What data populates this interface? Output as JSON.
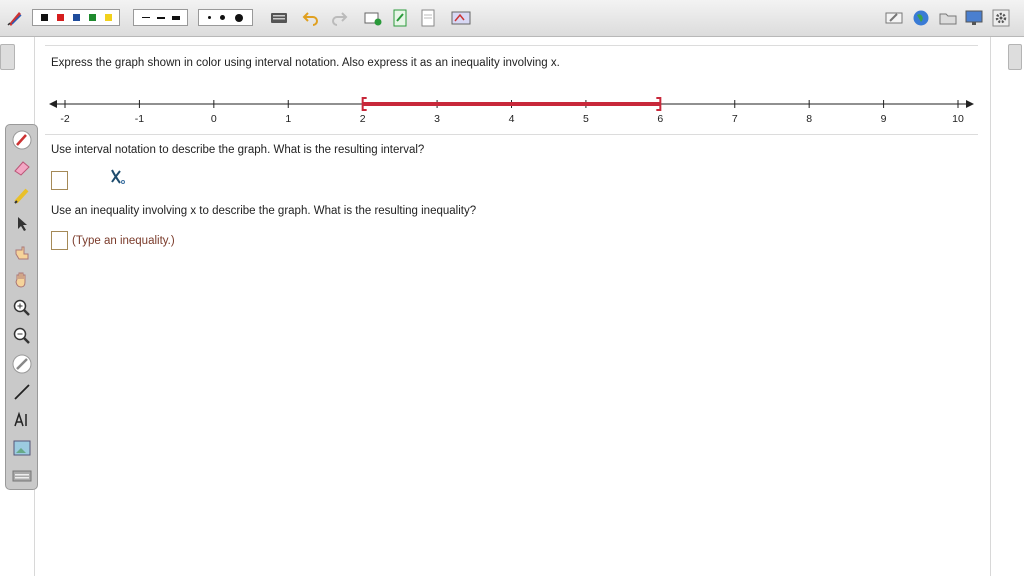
{
  "toolbar": {
    "colors": [
      "#111111",
      "#d51e1e",
      "#1f4c9c",
      "#1e8a2e",
      "#f2d11c"
    ],
    "icons": [
      "pen-logo",
      "keyboard-icon",
      "undo-icon",
      "redo-icon",
      "add-page-icon",
      "page-icon",
      "document-icon",
      "screen-capture-icon",
      "eraser-display-icon",
      "globe-icon",
      "folder-icon",
      "monitor-icon",
      "settings-icon"
    ]
  },
  "tools": [
    "pen-tool-icon",
    "eraser-icon",
    "highlighter-icon",
    "select-arrow-icon",
    "pointer-hand-icon",
    "pan-hand-icon",
    "zoom-in-icon",
    "zoom-out-icon",
    "clear-icon",
    "line-icon",
    "text-tool-icon",
    "image-icon",
    "keyboard-tool-icon"
  ],
  "question": {
    "prompt": "Express the graph shown in color using interval notation.  Also express it as an inequality involving x.",
    "part1": "Use interval notation to describe the graph.  What is the resulting interval?",
    "part2": "Use an inequality involving x to describe the graph.  What is the resulting inequality?",
    "hint2": "(Type an inequality.)"
  },
  "number_line": {
    "ticks": [
      "-2",
      "-1",
      "0",
      "1",
      "2",
      "3",
      "4",
      "5",
      "6",
      "7",
      "8",
      "9",
      "10"
    ],
    "min": -2,
    "max": 10,
    "interval_start": 2,
    "interval_end": 6,
    "left_bracket": "[",
    "right_bracket": "]",
    "interval_color": "#c8283a"
  }
}
